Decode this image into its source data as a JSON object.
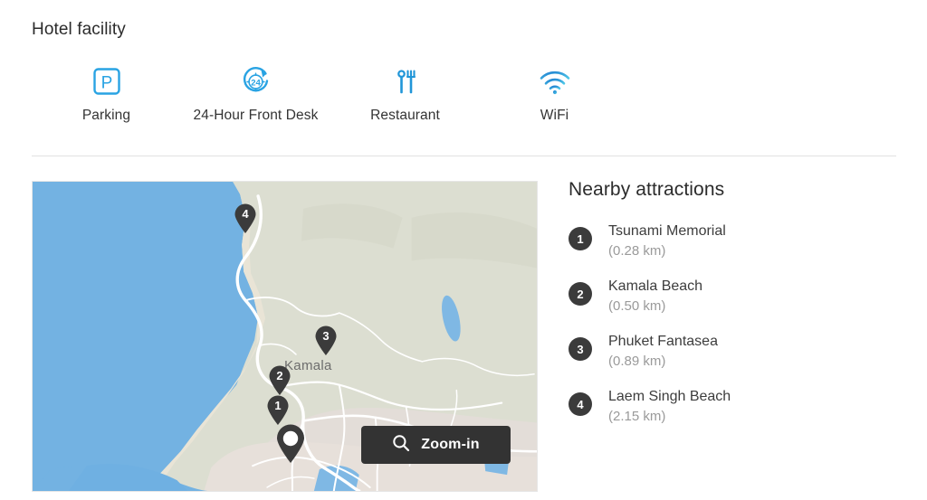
{
  "section": {
    "title": "Hotel facility"
  },
  "facilities": [
    {
      "icon": "parking-icon",
      "label": "Parking"
    },
    {
      "icon": "24-hour-clock-icon",
      "label": "24-Hour Front Desk"
    },
    {
      "icon": "restaurant-cutlery-icon",
      "label": "Restaurant"
    },
    {
      "icon": "wifi-icon",
      "label": "WiFi"
    }
  ],
  "map": {
    "place_label": "Kamala",
    "zoom_button": {
      "label": "Zoom-in",
      "icon": "search-magnifier-icon"
    },
    "markers": [
      {
        "number": "1"
      },
      {
        "number": "2"
      },
      {
        "number": "3"
      },
      {
        "number": "4"
      },
      {
        "number": "",
        "type": "hotel-location-pin"
      }
    ],
    "colors": {
      "water": "#73b2e2",
      "land": "#dcded1",
      "urban": "#e3ddd8",
      "road": "#ffffff"
    }
  },
  "attractions": {
    "title": "Nearby attractions",
    "items": [
      {
        "num": "1",
        "name": "Tsunami Memorial",
        "distance": "(0.28 km)"
      },
      {
        "num": "2",
        "name": "Kamala Beach",
        "distance": "(0.50 km)"
      },
      {
        "num": "3",
        "name": "Phuket Fantasea",
        "distance": "(0.89 km)"
      },
      {
        "num": "4",
        "name": "Laem Singh Beach",
        "distance": "(2.15 km)"
      }
    ]
  },
  "colors": {
    "accent": "#29a3e3",
    "dark": "#333333",
    "muted": "#9a9a9a"
  }
}
